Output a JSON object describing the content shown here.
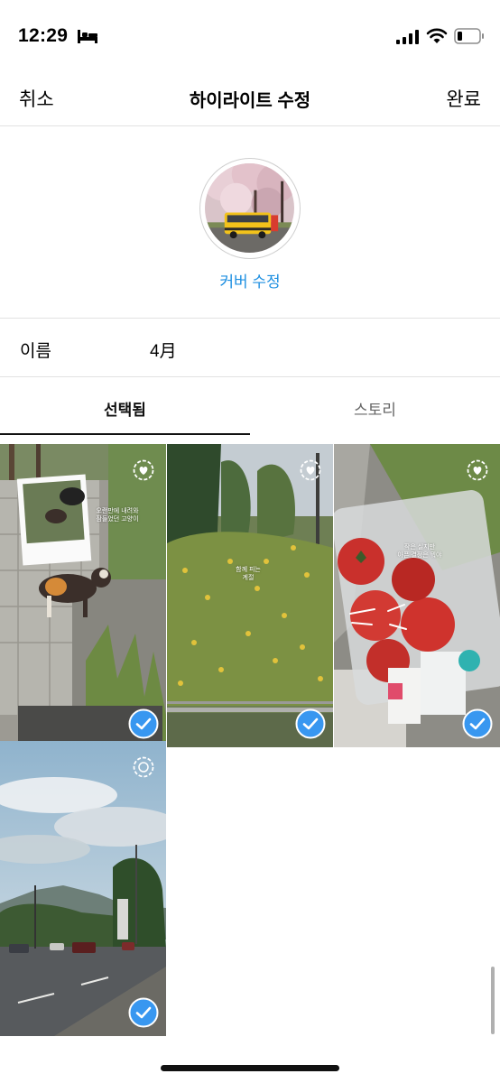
{
  "status_bar": {
    "time": "12:29",
    "icons": [
      "bed-icon",
      "signal-icon",
      "wifi-icon",
      "battery-icon"
    ]
  },
  "nav": {
    "cancel_label": "취소",
    "title": "하이라이트 수정",
    "done_label": "완료"
  },
  "cover": {
    "edit_label": "커버 수정",
    "image": "cherry-blossom-yellow-bus"
  },
  "name_field": {
    "label": "이름",
    "value": "4月"
  },
  "tabs": [
    {
      "label": "선택됨",
      "active": true
    },
    {
      "label": "스토리",
      "active": false
    }
  ],
  "stories": [
    {
      "scene": "cat-on-sidewalk",
      "selected": true,
      "overlay_text": "오랜만에 내려와\n잠들었던 고양이"
    },
    {
      "scene": "green-bushes-path",
      "selected": true,
      "overlay_text": "함께 피는 계절"
    },
    {
      "scene": "tomatoes-in-box",
      "selected": true,
      "overlay_text": "작은 실지만 아픈 결정은 뭐야"
    },
    {
      "scene": "sky-road-cars",
      "selected": true,
      "overlay_text": ""
    }
  ],
  "colors": {
    "accent": "#1d8fe1",
    "divider": "#e2e2e2",
    "check": "#3897f0"
  }
}
